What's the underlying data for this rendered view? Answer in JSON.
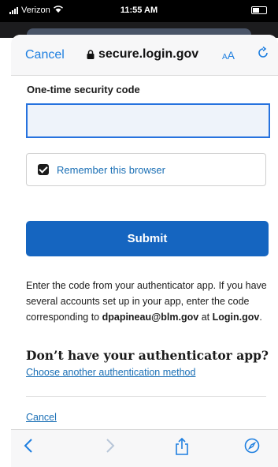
{
  "status_bar": {
    "carrier": "Verizon",
    "time": "11:55 AM"
  },
  "browser": {
    "cancel_label": "Cancel",
    "domain": "secure.login.gov",
    "text_size_label_small": "A",
    "text_size_label_large": "A"
  },
  "form": {
    "code_label": "One-time security code",
    "code_value": "",
    "remember_label": "Remember this browser",
    "remember_checked": true,
    "submit_label": "Submit"
  },
  "help": {
    "text_part1": "Enter the code from your authenticator app. If you have several accounts set up in your app, enter the code corresponding to ",
    "email": "dpapineau@blm.gov",
    "text_part2": " at ",
    "site": "Login.gov",
    "text_part3": "."
  },
  "alternative": {
    "heading": "Don’t have your authenticator app?",
    "link_label": "Choose another authentication method"
  },
  "cancel_link": "Cancel",
  "colors": {
    "primary": "#1565c0",
    "link": "#1a6fb5",
    "ios_blue": "#1e7fe0"
  }
}
